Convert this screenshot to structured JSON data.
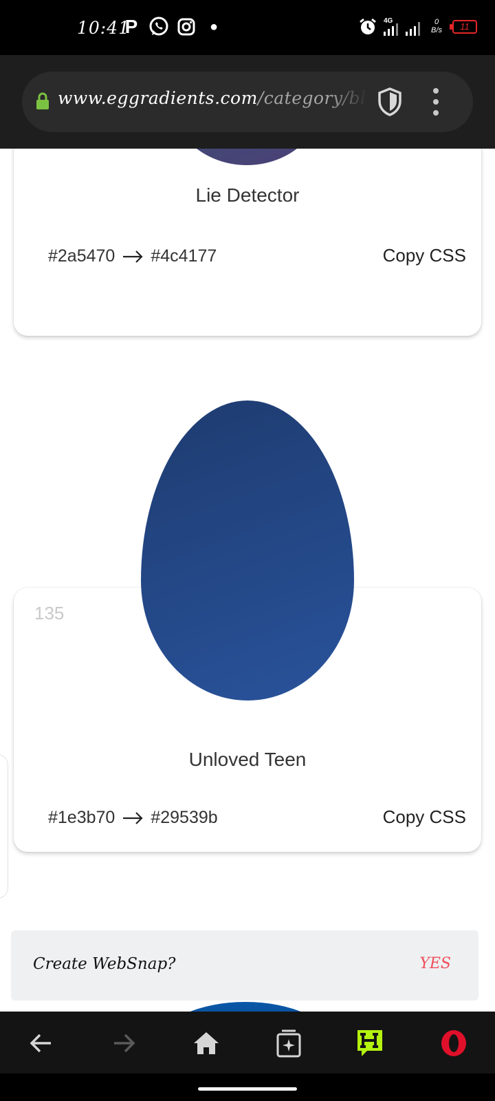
{
  "status_bar": {
    "time": "10:41",
    "notification_icons": [
      "p-icon",
      "whatsapp-icon",
      "instagram-icon",
      "more-dot-icon"
    ],
    "network_type": "4G",
    "speed_value": "0",
    "speed_unit": "B/s",
    "battery": "11",
    "battery_color": "#e8262a"
  },
  "browser": {
    "url_domain": "www.eggradients.com",
    "url_path": "/category/black-",
    "lock_color": "#7cc242"
  },
  "cards": [
    {
      "number": "",
      "title": "Lie Detector",
      "color_from": "#2a5470",
      "color_to": "#4c4177",
      "action": "Copy CSS"
    },
    {
      "number": "135",
      "title": "Unloved Teen",
      "color_from": "#1e3b70",
      "color_to": "#29539b",
      "action": "Copy CSS"
    }
  ],
  "websnap": {
    "question": "Create WebSnap?",
    "action": "YES",
    "action_color": "#ef4e5b"
  },
  "bottom_nav": {
    "items": [
      "back-icon",
      "forward-icon",
      "home-icon",
      "tabs-icon",
      "hype-icon",
      "opera-icon"
    ],
    "hype_color": "#b4f20f",
    "opera_color": "#e0102a"
  }
}
